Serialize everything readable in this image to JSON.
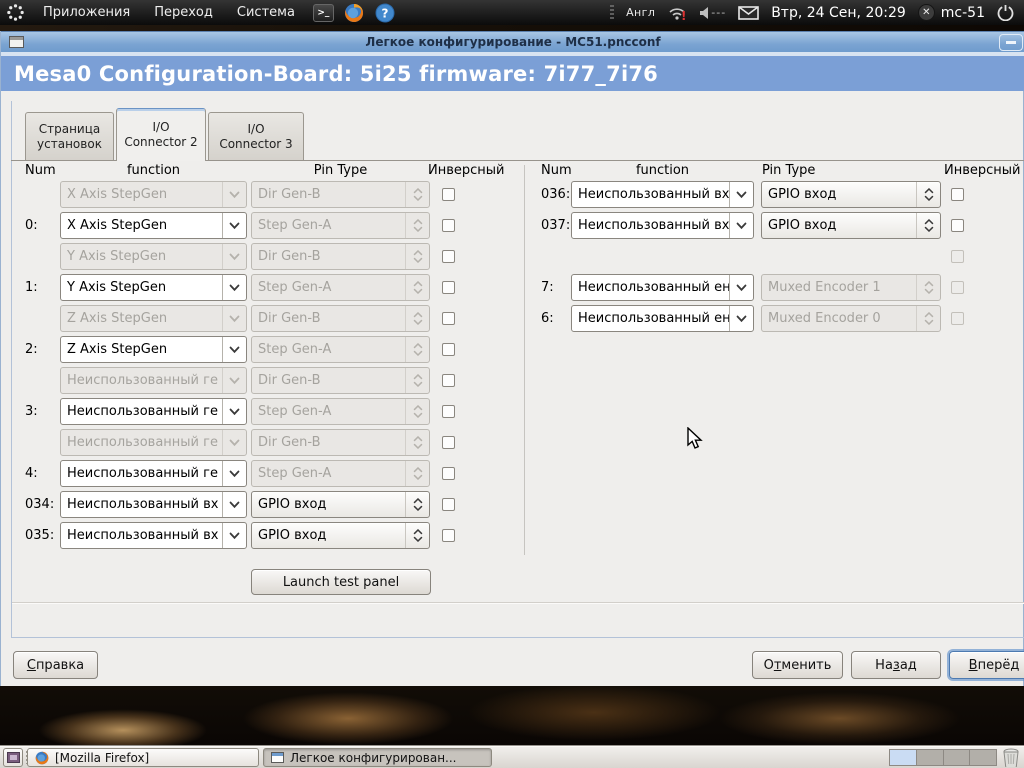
{
  "panel": {
    "menus": [
      {
        "id": "applications",
        "label": "Приложения"
      },
      {
        "id": "places",
        "label": "Переход"
      },
      {
        "id": "system",
        "label": "Система"
      }
    ],
    "keyboard_layout": "Англ",
    "clock": "Втр, 24 Сен, 20:29",
    "user": "mc-51",
    "icons": {
      "terminal": ">_",
      "help": "?",
      "volume_dashes": "---",
      "user_badge": "✕"
    }
  },
  "window": {
    "title": "Легкое конфигурирование - MC51.pncconf",
    "header": "Mesa0 Configuration-Board: 5i25 firmware: 7i77_7i76",
    "tabs": [
      {
        "line1": "Страница",
        "line2": "установок",
        "active": false
      },
      {
        "line1": "I/O",
        "line2": "Connector 2",
        "active": true
      },
      {
        "line1": "I/O",
        "line2": "Connector 3",
        "active": false
      }
    ]
  },
  "table": {
    "headers": {
      "num": "Num",
      "function": "function",
      "pin_type": "Pin Type",
      "invert": "Инверсный"
    },
    "left_rows": [
      {
        "num": "",
        "fn": "X Axis StepGen",
        "fn_dis": true,
        "pin": "Dir Gen-B",
        "pin_dis": true,
        "cb_dis": false
      },
      {
        "num": "0:",
        "fn": "X Axis StepGen",
        "fn_dis": false,
        "pin": "Step Gen-A",
        "pin_dis": true,
        "cb_dis": false
      },
      {
        "num": "",
        "fn": "Y Axis StepGen",
        "fn_dis": true,
        "pin": "Dir Gen-B",
        "pin_dis": true,
        "cb_dis": false
      },
      {
        "num": "1:",
        "fn": "Y Axis StepGen",
        "fn_dis": false,
        "pin": "Step Gen-A",
        "pin_dis": true,
        "cb_dis": false
      },
      {
        "num": "",
        "fn": "Z Axis StepGen",
        "fn_dis": true,
        "pin": "Dir Gen-B",
        "pin_dis": true,
        "cb_dis": false
      },
      {
        "num": "2:",
        "fn": "Z Axis StepGen",
        "fn_dis": false,
        "pin": "Step Gen-A",
        "pin_dis": true,
        "cb_dis": false
      },
      {
        "num": "",
        "fn": "Неиспользованный ге",
        "fn_dis": true,
        "pin": "Dir Gen-B",
        "pin_dis": true,
        "cb_dis": false
      },
      {
        "num": "3:",
        "fn": "Неиспользованный ге",
        "fn_dis": false,
        "pin": "Step Gen-A",
        "pin_dis": true,
        "cb_dis": false
      },
      {
        "num": "",
        "fn": "Неиспользованный ге",
        "fn_dis": true,
        "pin": "Dir Gen-B",
        "pin_dis": true,
        "cb_dis": false
      },
      {
        "num": "4:",
        "fn": "Неиспользованный ге",
        "fn_dis": false,
        "pin": "Step Gen-A",
        "pin_dis": true,
        "cb_dis": false
      },
      {
        "num": "034:",
        "fn": "Неиспользованный вх",
        "fn_dis": false,
        "pin": "GPIO вход",
        "pin_dis": false,
        "cb_dis": false
      },
      {
        "num": "035:",
        "fn": "Неиспользованный вх",
        "fn_dis": false,
        "pin": "GPIO вход",
        "pin_dis": false,
        "cb_dis": false
      }
    ],
    "right_rows": [
      {
        "num": "036:",
        "fn": "Неиспользованный вх",
        "fn_dis": false,
        "pin": "GPIO вход",
        "pin_dis": false,
        "cb_dis": false
      },
      {
        "num": "037:",
        "fn": "Неиспользованный вх",
        "fn_dis": false,
        "pin": "GPIO вход",
        "pin_dis": false,
        "cb_dis": false
      },
      {
        "gap": true,
        "cb_dis": true
      },
      {
        "num": "7:",
        "fn": "Неиспользованный ен",
        "fn_dis": false,
        "pin": "Muxed Encoder 1",
        "pin_dis": true,
        "cb_dis": true
      },
      {
        "num": "6:",
        "fn": "Неиспользованный ен",
        "fn_dis": false,
        "pin": "Muxed Encoder 0",
        "pin_dis": true,
        "cb_dis": true
      }
    ]
  },
  "launch_button": "Launch test panel",
  "actions": [
    {
      "id": "help",
      "label": "Справка",
      "underline_index": 0,
      "focused": false
    },
    {
      "id": "cancel",
      "label": "Отменить",
      "underline_index": 1,
      "focused": false
    },
    {
      "id": "back",
      "label": "Назад",
      "underline_index": 2,
      "focused": false
    },
    {
      "id": "forward",
      "label": "Вперёд",
      "underline_index": 0,
      "focused": true
    }
  ],
  "taskbar": {
    "windows": [
      {
        "label": "[Mozilla Firefox]",
        "icon": "firefox",
        "active": false
      },
      {
        "label": "Легкое конфигурирован...",
        "icon": "window",
        "active": true
      }
    ],
    "workspaces": {
      "count": 4,
      "active": 0
    }
  },
  "colors": {
    "header_bg": "#7b9fd6",
    "titlebar_bg": "#7fa8d4",
    "focus_ring": "#6192cc",
    "panel_bg": "#1a1a1a"
  }
}
